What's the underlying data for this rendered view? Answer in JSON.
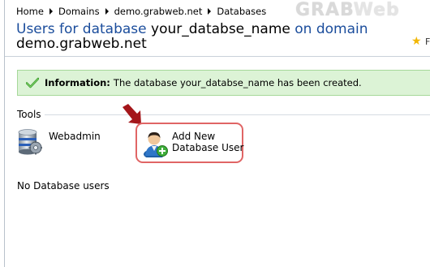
{
  "breadcrumb": {
    "items": [
      "Home",
      "Domains",
      "demo.grabweb.net",
      "Databases"
    ]
  },
  "logo": {
    "part1": "GRAB",
    "part2": "Web"
  },
  "title": {
    "prefix": "Users for database",
    "database": "your_databse_name",
    "middle": "on domain",
    "domain": "demo.grabweb.net"
  },
  "favorites": {
    "icon": "star-icon",
    "text": "F"
  },
  "info": {
    "icon": "check-icon",
    "label": "Information:",
    "message": "The database your_databse_name has been created."
  },
  "tools": {
    "heading": "Tools",
    "webadmin": {
      "label": "Webadmin",
      "icon": "database-icon"
    },
    "add_user": {
      "label_line1": "Add New",
      "label_line2": "Database User",
      "icon": "add-user-icon"
    }
  },
  "users": {
    "empty_text": "No Database users"
  },
  "colors": {
    "title_blue": "#1b4d9c",
    "info_bg": "#dcf3d6",
    "highlight_border": "#e06565",
    "arrow": "#a4161a"
  }
}
